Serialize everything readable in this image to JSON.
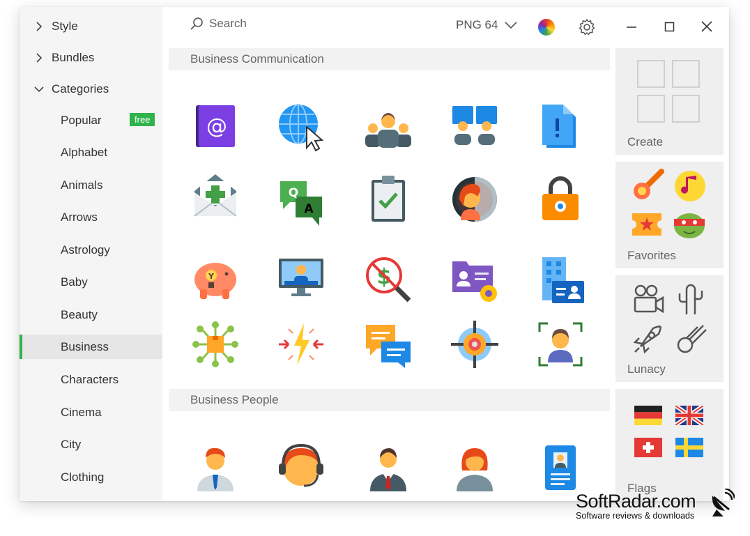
{
  "sidebar": {
    "top_items": [
      {
        "label": "Style",
        "expanded": false
      },
      {
        "label": "Bundles",
        "expanded": false
      },
      {
        "label": "Categories",
        "expanded": true
      }
    ],
    "categories": [
      {
        "label": "Popular",
        "badge": "free"
      },
      {
        "label": "Alphabet"
      },
      {
        "label": "Animals"
      },
      {
        "label": "Arrows"
      },
      {
        "label": "Astrology"
      },
      {
        "label": "Baby"
      },
      {
        "label": "Beauty"
      },
      {
        "label": "Business",
        "selected": true
      },
      {
        "label": "Characters"
      },
      {
        "label": "Cinema"
      },
      {
        "label": "City"
      },
      {
        "label": "Clothing"
      }
    ]
  },
  "toolbar": {
    "search_placeholder": "Search",
    "format_label": "PNG 64",
    "icons": [
      "search-icon",
      "chevron-down-icon",
      "color-wheel-icon",
      "gear-icon",
      "minimize-icon",
      "maximize-icon",
      "close-icon"
    ]
  },
  "sections": [
    {
      "title": "Business Communication",
      "icons": [
        "email-icon",
        "web-click-icon",
        "team-icon",
        "video-conference-icon",
        "important-document-icon",
        "add-mail-icon",
        "qa-chat-icon",
        "checklist-icon",
        "user-profile-icon",
        "padlock-icon",
        "piggy-bank-icon",
        "online-presentation-icon",
        "no-money-search-icon",
        "business-card-settings-icon",
        "office-building-id-icon",
        "network-box-icon",
        "conflict-lightning-icon",
        "speech-bubbles-icon",
        "target-icon",
        "face-id-icon"
      ]
    },
    {
      "title": "Business People",
      "icons": [
        "businessman-icon",
        "support-headset-icon",
        "manager-icon",
        "businesswoman-icon",
        "id-card-icon"
      ]
    }
  ],
  "right_panel": {
    "cards": [
      {
        "label": "Create"
      },
      {
        "label": "Favorites"
      },
      {
        "label": "Lunacy"
      },
      {
        "label": "Flags"
      }
    ]
  },
  "watermark": {
    "title": "SoftRadar.com",
    "subtitle": "Software reviews & downloads"
  },
  "colors": {
    "accent_green": "#2fb34a",
    "sidebar_bg": "#f5f5f5",
    "section_header_bg": "#f2f2f2",
    "card_bg": "#efefef"
  }
}
